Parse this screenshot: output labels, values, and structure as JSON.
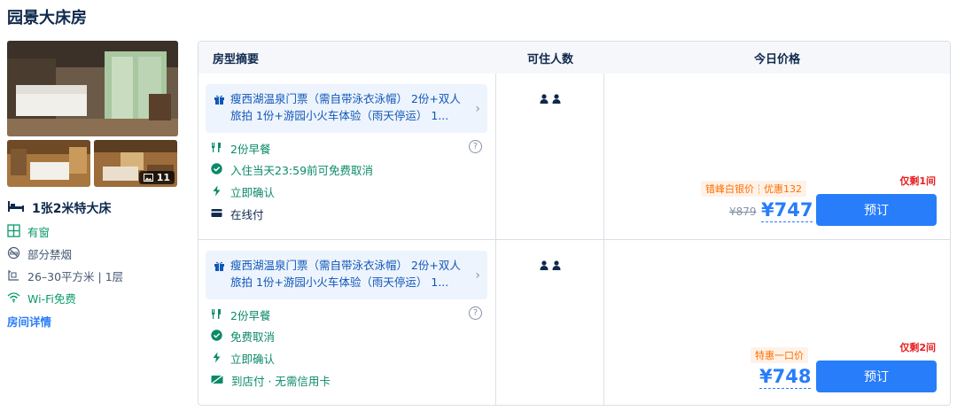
{
  "room": {
    "title": "园景大床房",
    "photo_count": "11",
    "bed": "1张2米特大床",
    "features": [
      {
        "icon": "window-icon",
        "label": "有窗"
      },
      {
        "icon": "no-smoking-icon",
        "label": "部分禁烟"
      },
      {
        "icon": "area-icon",
        "label": "26–30平方米 | 1层"
      },
      {
        "icon": "wifi-icon",
        "label": "Wi-Fi免费"
      }
    ],
    "details_link": "房间详情"
  },
  "table": {
    "headers": [
      "房型摘要",
      "可住人数",
      "今日价格"
    ]
  },
  "offers": [
    {
      "package": "瘦西湖温泉门票（需自带泳衣泳帽） 2份+双人旅拍 1份+游园小火车体验（雨天停运） 1...",
      "breakfast": "2份早餐",
      "cancel": "入住当天23:59前可免费取消",
      "confirm": "立即确认",
      "payment": "在线付",
      "remaining": "仅剩1间",
      "tags": [
        "错峰白银价",
        "优惠132"
      ],
      "original_price": "¥879",
      "price": "¥747",
      "book_label": "预订"
    },
    {
      "package": "瘦西湖温泉门票（需自带泳衣泳帽） 2份+双人旅拍 1份+游园小火车体验（雨天停运） 1...",
      "breakfast": "2份早餐",
      "cancel": "免费取消",
      "confirm": "立即确认",
      "payment": "到店付 · 无需信用卡",
      "remaining": "仅剩2间",
      "tags": [
        "特惠一口价"
      ],
      "price": "¥748",
      "book_label": "预订"
    }
  ],
  "colors": {
    "accent": "#287dfa",
    "green": "#0b8a6a",
    "orange": "#ff6f00",
    "red": "#e81d1d"
  }
}
